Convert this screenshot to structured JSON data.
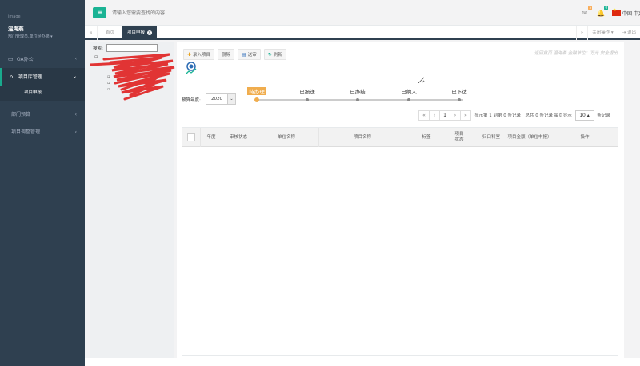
{
  "sidebar": {
    "profile": {
      "image_label": "image",
      "name": "温海燕",
      "dept": "部门管理员,单位经办岗 ▾"
    },
    "items": [
      {
        "label": "OA办公",
        "icon": "desktop-icon"
      },
      {
        "label": "项目库管理",
        "icon": "home-icon"
      },
      {
        "label": "项目申报"
      },
      {
        "label": "部门预算"
      },
      {
        "label": "项目调整管理"
      }
    ]
  },
  "topbar": {
    "search_placeholder": "请输入您需要查找的内容 ...",
    "mail_badge": "5",
    "bell_badge": "0",
    "language": "中国 中文",
    "colors": {
      "mail_badge": "#f8ac59",
      "bell_badge": "#1ab394",
      "accent": "#1ab394"
    }
  },
  "tabs": {
    "home": "首页",
    "active": "项目申报",
    "close_tabs": "关闭操作 ▾",
    "exit": "退出"
  },
  "tree": {
    "search_label": "搜索:"
  },
  "toolbar": {
    "import_label": "录入项目",
    "delete_label": "删除",
    "submit_label": "送审",
    "refresh_label": "刷新",
    "hint": "返回首页 温海燕      金融单位：万元  安全退出"
  },
  "filter": {
    "year_label": "预算年度:",
    "year_value": "2020"
  },
  "steps": [
    {
      "label": "待办理"
    },
    {
      "label": "已报送"
    },
    {
      "label": "已办结"
    },
    {
      "label": "已纳入"
    },
    {
      "label": "已下达"
    }
  ],
  "pagination": {
    "first": "«",
    "prev": "‹",
    "current": "1",
    "next": "›",
    "last": "»",
    "info": "显示第 1 到第 0 条记录，总共 0 条记录  每页显示",
    "page_size": "10 ▴",
    "suffix": "条记录"
  },
  "table": {
    "columns": [
      "年度",
      "审核状态",
      "单位名称",
      "项目名称",
      "标签",
      "项目状态",
      "归口科室",
      "项目金额（单位申报）",
      "操作"
    ]
  }
}
